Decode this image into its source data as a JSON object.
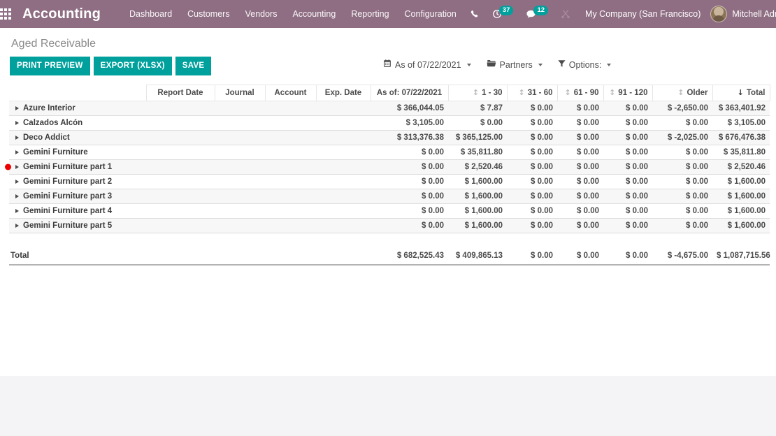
{
  "navbar": {
    "apps_icon": "apps-grid-icon",
    "brand": "Accounting",
    "menu": [
      {
        "label": "Dashboard"
      },
      {
        "label": "Customers"
      },
      {
        "label": "Vendors"
      },
      {
        "label": "Accounting"
      },
      {
        "label": "Reporting"
      },
      {
        "label": "Configuration"
      }
    ],
    "icons": [
      {
        "name": "phone-icon",
        "badge": null
      },
      {
        "name": "activity-clock-icon",
        "badge": "37"
      },
      {
        "name": "messages-chat-icon",
        "badge": "12"
      },
      {
        "name": "shortcuts-scissors-icon",
        "badge": null
      }
    ],
    "company": "My Company (San Francisco)",
    "user": "Mitchell Admin",
    "avatar": "user-avatar",
    "bg_color": "#8f6e84",
    "badge_color": "#00a09d"
  },
  "control_panel": {
    "breadcrumb": "Aged Receivable",
    "buttons": [
      {
        "label": "PRINT PREVIEW",
        "name": "print-preview-button"
      },
      {
        "label": "EXPORT (XLSX)",
        "name": "export-xlsx-button"
      },
      {
        "label": "SAVE",
        "name": "save-button"
      }
    ],
    "button_color": "#00a09d",
    "filters": [
      {
        "icon": "calendar-icon",
        "label": "As of 07/22/2021",
        "name": "date-filter"
      },
      {
        "icon": "folder-icon",
        "label": "Partners",
        "name": "partners-filter"
      },
      {
        "icon": "funnel-icon",
        "label": "Options:",
        "name": "options-filter"
      }
    ]
  },
  "table": {
    "headers": [
      {
        "label": "Report Date",
        "align": "center",
        "sort": null
      },
      {
        "label": "Journal",
        "align": "center",
        "sort": null
      },
      {
        "label": "Account",
        "align": "center",
        "sort": null
      },
      {
        "label": "Exp. Date",
        "align": "center",
        "sort": null
      },
      {
        "label": "As of: 07/22/2021",
        "align": "center",
        "sort": null
      },
      {
        "label": "1 - 30",
        "align": "right",
        "sort": "inactive"
      },
      {
        "label": "31 - 60",
        "align": "right",
        "sort": "inactive"
      },
      {
        "label": "61 - 90",
        "align": "right",
        "sort": "inactive"
      },
      {
        "label": "91 - 120",
        "align": "right",
        "sort": "inactive"
      },
      {
        "label": "Older",
        "align": "right",
        "sort": "inactive"
      },
      {
        "label": "Total",
        "align": "right",
        "sort": "active-desc"
      }
    ],
    "rows": [
      {
        "name": "Azure Interior",
        "marker": false,
        "values": [
          "$ 366,044.05",
          "$ 7.87",
          "$ 0.00",
          "$ 0.00",
          "$ 0.00",
          "$ -2,650.00",
          "$ 363,401.92"
        ]
      },
      {
        "name": "Calzados Alcón",
        "marker": false,
        "values": [
          "$ 3,105.00",
          "$ 0.00",
          "$ 0.00",
          "$ 0.00",
          "$ 0.00",
          "$ 0.00",
          "$ 3,105.00"
        ]
      },
      {
        "name": "Deco Addict",
        "marker": false,
        "values": [
          "$ 313,376.38",
          "$ 365,125.00",
          "$ 0.00",
          "$ 0.00",
          "$ 0.00",
          "$ -2,025.00",
          "$ 676,476.38"
        ]
      },
      {
        "name": "Gemini Furniture",
        "marker": false,
        "values": [
          "$ 0.00",
          "$ 35,811.80",
          "$ 0.00",
          "$ 0.00",
          "$ 0.00",
          "$ 0.00",
          "$ 35,811.80"
        ]
      },
      {
        "name": "Gemini Furniture part 1",
        "marker": true,
        "values": [
          "$ 0.00",
          "$ 2,520.46",
          "$ 0.00",
          "$ 0.00",
          "$ 0.00",
          "$ 0.00",
          "$ 2,520.46"
        ]
      },
      {
        "name": "Gemini Furniture part 2",
        "marker": false,
        "values": [
          "$ 0.00",
          "$ 1,600.00",
          "$ 0.00",
          "$ 0.00",
          "$ 0.00",
          "$ 0.00",
          "$ 1,600.00"
        ]
      },
      {
        "name": "Gemini Furniture part 3",
        "marker": false,
        "values": [
          "$ 0.00",
          "$ 1,600.00",
          "$ 0.00",
          "$ 0.00",
          "$ 0.00",
          "$ 0.00",
          "$ 1,600.00"
        ]
      },
      {
        "name": "Gemini Furniture part 4",
        "marker": false,
        "values": [
          "$ 0.00",
          "$ 1,600.00",
          "$ 0.00",
          "$ 0.00",
          "$ 0.00",
          "$ 0.00",
          "$ 1,600.00"
        ]
      },
      {
        "name": "Gemini Furniture part 5",
        "marker": false,
        "values": [
          "$ 0.00",
          "$ 1,600.00",
          "$ 0.00",
          "$ 0.00",
          "$ 0.00",
          "$ 0.00",
          "$ 1,600.00"
        ]
      }
    ],
    "total": {
      "label": "Total",
      "values": [
        "$ 682,525.43",
        "$ 409,865.13",
        "$ 0.00",
        "$ 0.00",
        "$ 0.00",
        "$ -4,675.00",
        "$ 1,087,715.56"
      ]
    },
    "marker_color": "#ee0000"
  }
}
